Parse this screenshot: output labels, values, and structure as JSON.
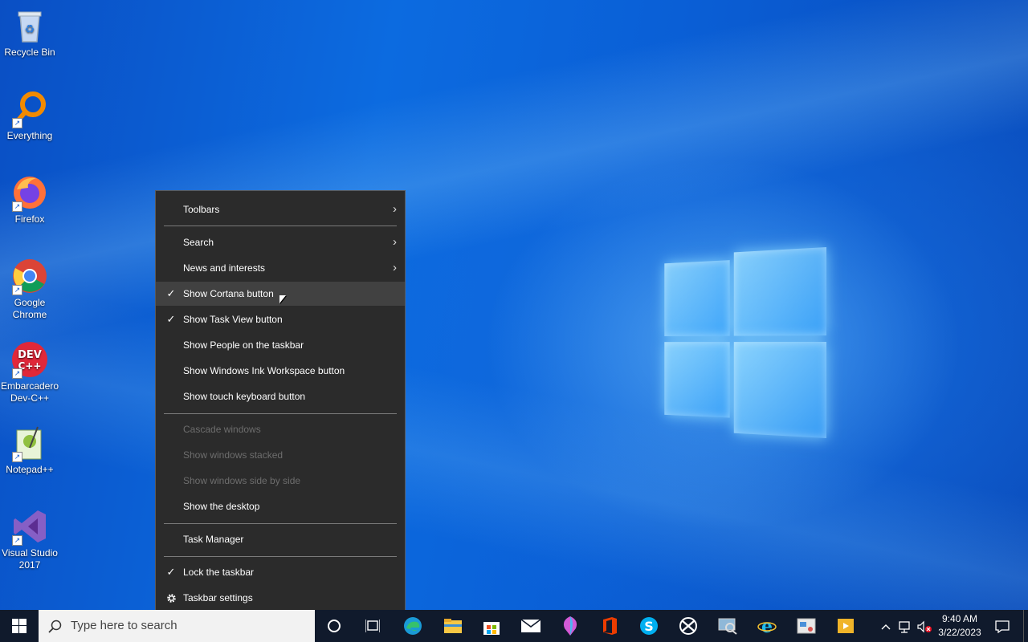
{
  "desktop": {
    "icons": [
      {
        "label": "Recycle Bin",
        "icon": "recycle-bin-icon"
      },
      {
        "label": "Everything",
        "icon": "everything-search-icon"
      },
      {
        "label": "Firefox",
        "icon": "firefox-icon"
      },
      {
        "label": "Google Chrome",
        "icon": "chrome-icon"
      },
      {
        "label": "Embarcadero Dev-C++",
        "icon": "devcpp-icon"
      },
      {
        "label": "Notepad++",
        "icon": "notepadpp-icon"
      },
      {
        "label": "Visual Studio 2017",
        "icon": "visual-studio-icon"
      }
    ]
  },
  "context_menu": {
    "items": [
      {
        "label": "Toolbars",
        "submenu": true
      },
      {
        "label": "Search",
        "submenu": true
      },
      {
        "label": "News and interests",
        "submenu": true
      },
      {
        "label": "Show Cortana button",
        "checked": true,
        "hovered": true
      },
      {
        "label": "Show Task View button",
        "checked": true
      },
      {
        "label": "Show People on the taskbar"
      },
      {
        "label": "Show Windows Ink Workspace button"
      },
      {
        "label": "Show touch keyboard button"
      },
      {
        "label": "Cascade windows",
        "disabled": true
      },
      {
        "label": "Show windows stacked",
        "disabled": true
      },
      {
        "label": "Show windows side by side",
        "disabled": true
      },
      {
        "label": "Show the desktop"
      },
      {
        "label": "Task Manager"
      },
      {
        "label": "Lock the taskbar",
        "checked": true
      },
      {
        "label": "Taskbar settings",
        "icon": "gear-icon"
      }
    ],
    "check_glyph": "✓",
    "arrow_glyph": "›"
  },
  "taskbar": {
    "search_placeholder": "Type here to search",
    "pinned": [
      "cortana-icon",
      "task-view-icon",
      "edge-icon",
      "file-explorer-icon",
      "store-icon",
      "mail-icon",
      "paint3d-icon",
      "office-icon",
      "skype-icon",
      "xbox-icon",
      "remote-desktop-icon",
      "internet-explorer-icon",
      "snip-icon",
      "video-player-icon"
    ],
    "clock": {
      "time": "9:40 AM",
      "date": "3/22/2023"
    }
  },
  "colors": {
    "menu_bg": "#2b2b2b",
    "menu_hover": "#414141",
    "menu_disabled_text": "#6d6d6d",
    "taskbar_bg": "#101a2c"
  }
}
